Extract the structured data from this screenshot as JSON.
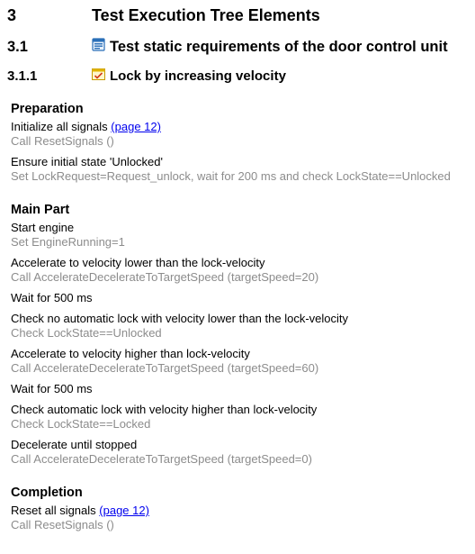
{
  "headings": {
    "h1": {
      "number": "3",
      "title": "Test Execution Tree Elements"
    },
    "h2": {
      "number": "3.1",
      "title": "Test static requirements of the door control unit",
      "icon": "test-group-icon"
    },
    "h3": {
      "number": "3.1.1",
      "title": "Lock by increasing velocity",
      "icon": "test-case-icon"
    }
  },
  "preparation": {
    "title": "Preparation",
    "steps": [
      {
        "text": "Initialize all signals",
        "link": "(page 12)",
        "action": "Call ResetSignals ()"
      },
      {
        "text": "Ensure initial state 'Unlocked'",
        "action": "Set LockRequest=Request_unlock, wait for 200 ms and check LockState==Unlocked"
      }
    ]
  },
  "main_part": {
    "title": "Main Part",
    "steps": [
      {
        "text": "Start engine",
        "action": "Set EngineRunning=1"
      },
      {
        "text": "Accelerate to velocity lower than the lock-velocity",
        "action": "Call AccelerateDecelerateToTargetSpeed (targetSpeed=20)"
      },
      {
        "text": "Wait for 500 ms"
      },
      {
        "text": "Check no automatic lock with velocity lower than the lock-velocity",
        "action": "Check LockState==Unlocked"
      },
      {
        "text": "Accelerate to velocity higher than lock-velocity",
        "action": "Call AccelerateDecelerateToTargetSpeed (targetSpeed=60)"
      },
      {
        "text": "Wait for 500 ms"
      },
      {
        "text": "Check automatic lock with velocity higher than lock-velocity",
        "action": "Check LockState==Locked"
      },
      {
        "text": "Decelerate until stopped",
        "action": "Call AccelerateDecelerateToTargetSpeed (targetSpeed=0)"
      }
    ]
  },
  "completion": {
    "title": "Completion",
    "steps": [
      {
        "text": "Reset all signals",
        "link": "(page 12)",
        "action": "Call ResetSignals ()"
      }
    ]
  }
}
